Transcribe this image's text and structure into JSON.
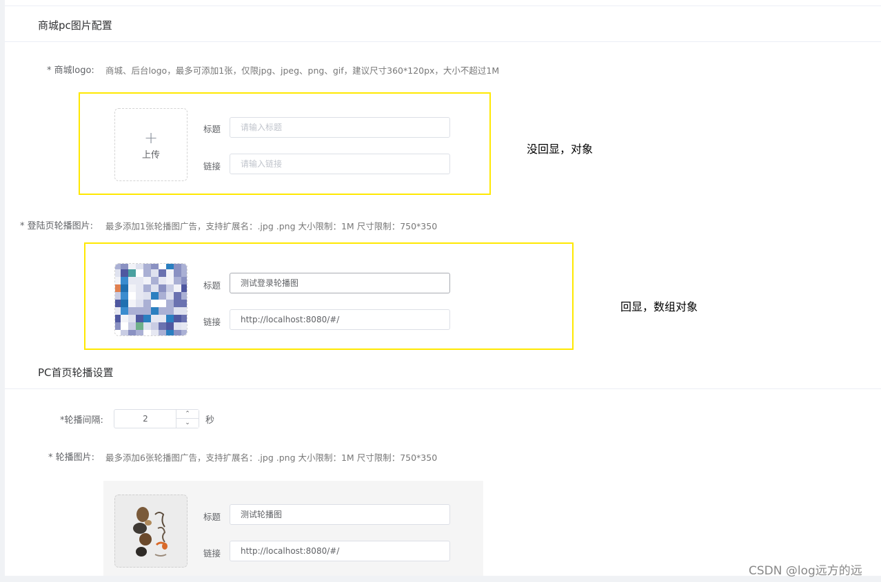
{
  "pc_image_config": {
    "title": "商城pc图片配置",
    "logo": {
      "label": "* 商城logo:",
      "hint": "商城、后台logo，最多可添加1张，仅限jpg、jpeg、png、gif，建议尺寸360*120px，大小不超过1M",
      "upload_plus": "+",
      "upload_text": "上传",
      "title_label": "标题",
      "title_placeholder": "请输入标题",
      "link_label": "链接",
      "link_placeholder": "请输入链接",
      "annotation": "没回显，对象"
    },
    "login_carousel": {
      "label": "* 登陆页轮播图片:",
      "hint": "最多添加1张轮播图广告，支持扩展名：.jpg .png 大小限制：1M 尺寸限制：750*350",
      "title_label": "标题",
      "title_value": "测试登录轮播图",
      "link_label": "链接",
      "link_value": "http://localhost:8080/#/",
      "annotation": "回显，数组对象"
    }
  },
  "pc_home_carousel": {
    "title": "PC首页轮播设置",
    "interval": {
      "label": "*轮播间隔:",
      "value": "2",
      "unit": "秒"
    },
    "images": {
      "label": "* 轮播图片:",
      "hint": "最多添加6张轮播图广告，支持扩展名：.jpg .png 大小限制：1M 尺寸限制：750*350",
      "title_label": "标题",
      "title_value": "测试轮播图",
      "link_label": "链接",
      "link_value": "http://localhost:8080/#/"
    }
  },
  "watermark": "CSDN @log远方的远",
  "colors": {
    "annotation_border": "#ffe800",
    "input_border": "#dcdfe6",
    "placeholder": "#c0c4cc"
  }
}
